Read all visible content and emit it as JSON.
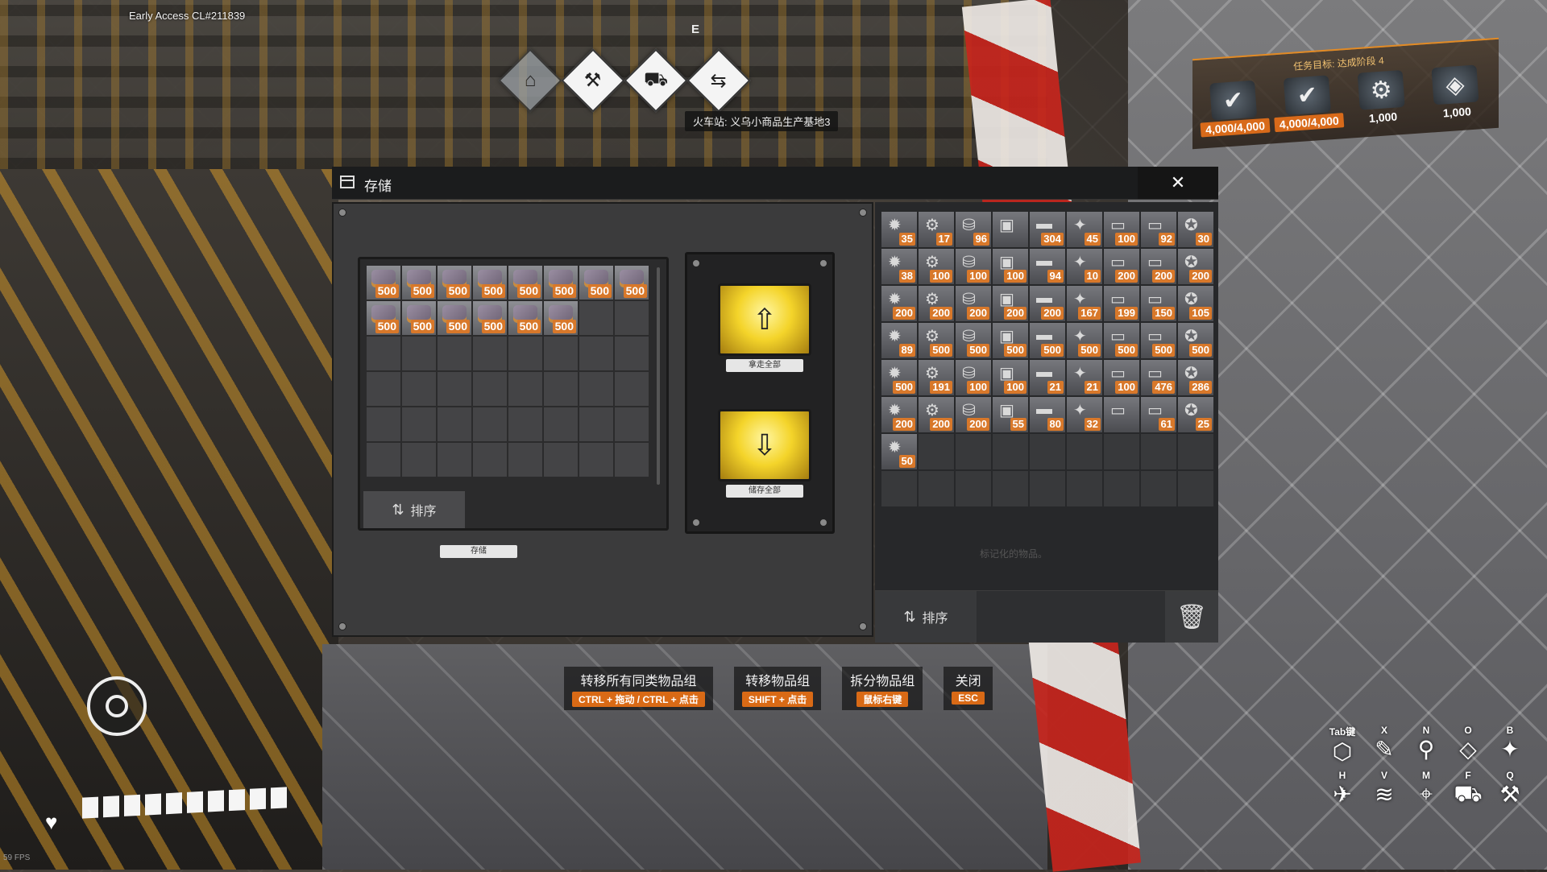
{
  "hud": {
    "build": "Early Access CL#211839",
    "fps": "59 FPS",
    "station_name": "火车站: 义乌小商品生产基地3",
    "station_key": "E"
  },
  "objective": {
    "title": "任务目标: 达成阶段 4",
    "items": [
      {
        "icon": "check-badge-icon",
        "glyph": "✔",
        "count": "4,000/4,000",
        "highlight": true
      },
      {
        "icon": "check-badge-icon",
        "glyph": "✔",
        "count": "4,000/4,000",
        "highlight": true
      },
      {
        "icon": "machine-part-icon",
        "glyph": "⚙",
        "count": "1,000",
        "highlight": false
      },
      {
        "icon": "robot-part-icon",
        "glyph": "◈",
        "count": "1,000",
        "highlight": false
      }
    ]
  },
  "window": {
    "title": "存储",
    "close_glyph": "✕"
  },
  "storage": {
    "label": "存储",
    "sort_label": "排序",
    "quantities": [
      "500",
      "500",
      "500",
      "500",
      "500",
      "500",
      "500",
      "500",
      "500",
      "500",
      "500",
      "500",
      "500",
      "500"
    ],
    "total_slots": 48
  },
  "actions": {
    "take_all": "拿走全部",
    "store_all": "储存全部"
  },
  "inventory": {
    "sort_label": "排序",
    "ghost_text": "标记化的物品。",
    "quantities": [
      "35",
      "17",
      "96",
      "",
      "304",
      "45",
      "100",
      "92",
      "30",
      "38",
      "100",
      "100",
      "100",
      "94",
      "10",
      "200",
      "200",
      "200",
      "200",
      "200",
      "200",
      "200",
      "200",
      "167",
      "199",
      "150",
      "105",
      "89",
      "500",
      "500",
      "500",
      "500",
      "500",
      "500",
      "500",
      "500",
      "500",
      "191",
      "100",
      "100",
      "21",
      "21",
      "100",
      "476",
      "286",
      "200",
      "200",
      "200",
      "55",
      "80",
      "32",
      "",
      "61",
      "25",
      "50"
    ],
    "total_slots": 72
  },
  "hints": [
    {
      "label": "转移所有同类物品组",
      "key": "CTRL + 拖动 / CTRL + 点击"
    },
    {
      "label": "转移物品组",
      "key": "SHIFT + 点击"
    },
    {
      "label": "拆分物品组",
      "key": "鼠标右键"
    },
    {
      "label": "关闭",
      "key": "ESC"
    }
  ],
  "health": {
    "segments": 10,
    "filled": 10
  },
  "hotkeys": [
    {
      "key": "Tab键",
      "icon": "cube-icon",
      "glyph": "⬡"
    },
    {
      "key": "X",
      "icon": "brush-icon",
      "glyph": "✎"
    },
    {
      "key": "N",
      "icon": "magnifier-icon",
      "glyph": "⚲"
    },
    {
      "key": "O",
      "icon": "blueprint-icon",
      "glyph": "◇"
    },
    {
      "key": "B",
      "icon": "flashlight-icon",
      "glyph": "✦"
    },
    {
      "key": "H",
      "icon": "plane-icon",
      "glyph": "✈"
    },
    {
      "key": "V",
      "icon": "wifi-icon",
      "glyph": "≋"
    },
    {
      "key": "M",
      "icon": "map-pin-icon",
      "glyph": "⌖"
    },
    {
      "key": "F",
      "icon": "vehicle-icon",
      "glyph": "⛟"
    },
    {
      "key": "Q",
      "icon": "hammer-icon",
      "glyph": "⚒"
    }
  ]
}
